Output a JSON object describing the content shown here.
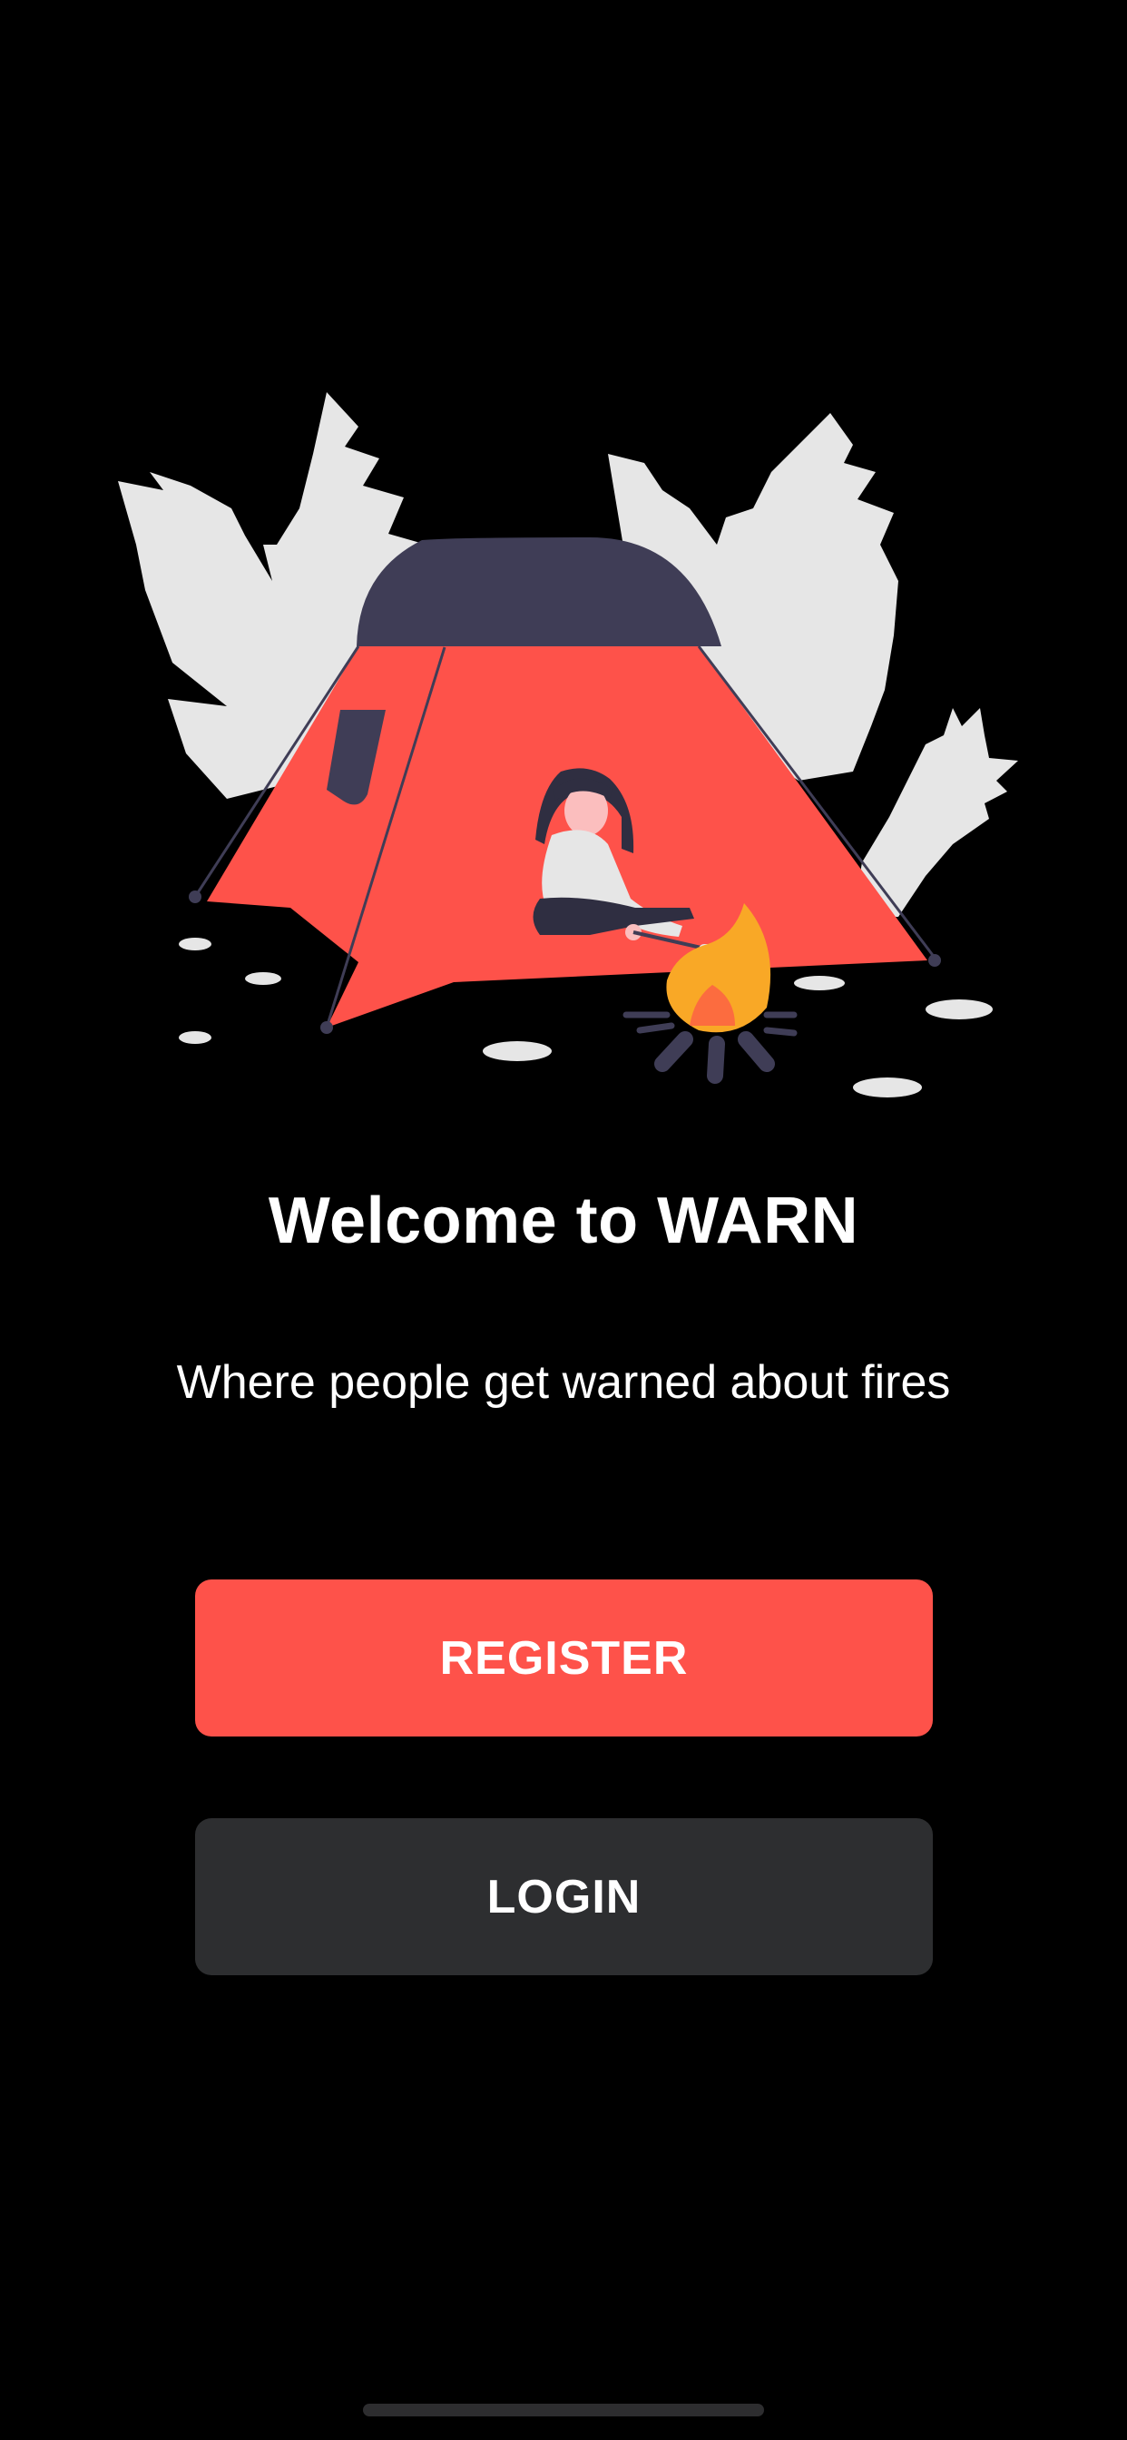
{
  "welcome": {
    "title": "Welcome to WARN",
    "subtitle": "Where people get warned about fires"
  },
  "actions": {
    "register_label": "REGISTER",
    "login_label": "LOGIN"
  },
  "colors": {
    "background": "#000000",
    "accent": "#fe524a",
    "secondary_button": "#2d2e30",
    "tent_top": "#3f3d56",
    "leaf": "#e6e6e6",
    "fire": "#f9a826"
  },
  "illustration": {
    "icon": "camping-tent-fire-illustration"
  }
}
